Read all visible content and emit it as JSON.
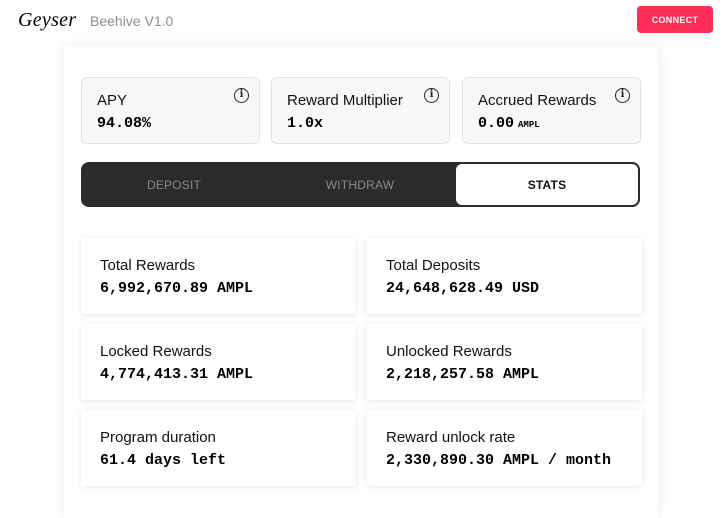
{
  "header": {
    "logo": "Geyser",
    "version": "Beehive V1.0",
    "connect_label": "CONNECT"
  },
  "info_cards": [
    {
      "label": "APY",
      "value": "94.08%",
      "unit": "",
      "icon": "info-icon"
    },
    {
      "label": "Reward Multiplier",
      "value": "1.0x",
      "unit": "",
      "icon": "info-icon"
    },
    {
      "label": "Accrued Rewards",
      "value": "0.00",
      "unit": "AMPL",
      "icon": "info-icon"
    }
  ],
  "tabs": [
    {
      "label": "DEPOSIT",
      "active": false
    },
    {
      "label": "WITHDRAW",
      "active": false
    },
    {
      "label": "STATS",
      "active": true
    }
  ],
  "stats": [
    {
      "label": "Total Rewards",
      "value": "6,992,670.89 AMPL"
    },
    {
      "label": "Total Deposits",
      "value": "24,648,628.49 USD"
    },
    {
      "label": "Locked Rewards",
      "value": "4,774,413.31 AMPL"
    },
    {
      "label": "Unlocked Rewards",
      "value": "2,218,257.58 AMPL"
    },
    {
      "label": "Program duration",
      "value": "61.4 days left"
    },
    {
      "label": "Reward unlock rate",
      "value": "2,330,890.30 AMPL / month"
    }
  ],
  "colors": {
    "accent": "#ff2d55",
    "tab_bg": "#2b2b2b"
  }
}
